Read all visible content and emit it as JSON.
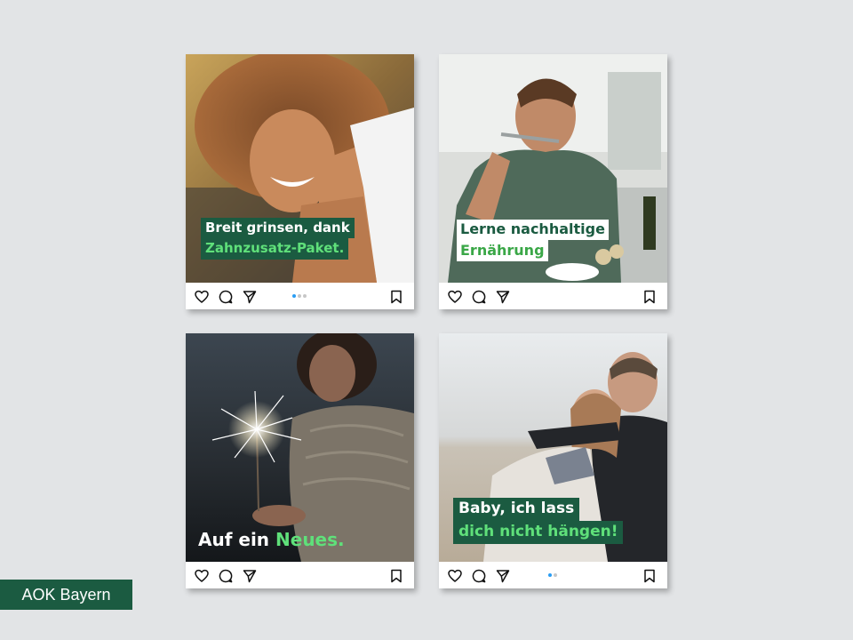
{
  "brand": {
    "label": "AOK Bayern",
    "color": "#1b5b41"
  },
  "colors": {
    "accent_green": "#5fe07a",
    "dark_green": "#1b5b41",
    "page_bg": "#e2e4e6",
    "carousel_dot_active": "#2a9df4"
  },
  "posts": [
    {
      "photo": "smiling woman with curly hair",
      "caption_line1": "Breit grinsen, dank",
      "caption_line2": "Zahnzusatz-Paket.",
      "carousel": {
        "count": 3,
        "active": 1
      }
    },
    {
      "photo": "man tasting food from a spoon in a kitchen",
      "caption_line1": "Lerne nachhaltige",
      "caption_line2": "Ernährung",
      "carousel": null
    },
    {
      "photo": "woman holding a lit sparkler",
      "caption_part1": "Auf ein ",
      "caption_part2": "Neues.",
      "carousel": null
    },
    {
      "photo": "couple embracing on a beach",
      "caption_line1": "Baby, ich lass",
      "caption_line2": "dich nicht hängen!",
      "carousel": {
        "count": 2,
        "active": 1
      }
    }
  ],
  "post_actions": [
    "heart-icon",
    "comment-icon",
    "share-icon",
    "bookmark-icon"
  ]
}
